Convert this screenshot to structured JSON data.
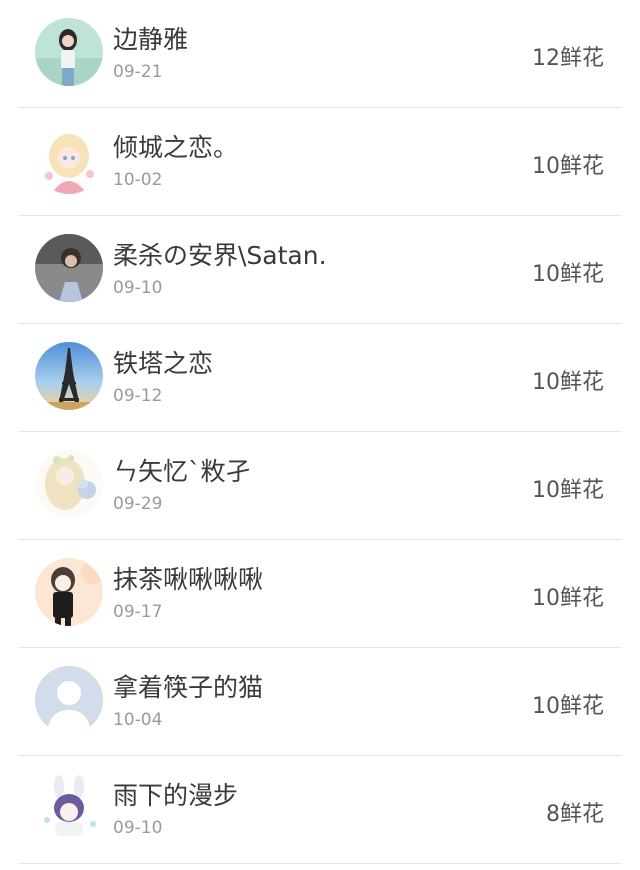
{
  "items": [
    {
      "name": "边静雅",
      "date": "09-21",
      "flowers": "12鲜花",
      "avatar": "girl-photo-avatar"
    },
    {
      "name": "倾城之恋。",
      "date": "10-02",
      "flowers": "10鲜花",
      "avatar": "anime-girl-pink-avatar"
    },
    {
      "name": "柔杀の安界\\Satan.",
      "date": "09-10",
      "flowers": "10鲜花",
      "avatar": "person-photo-avatar"
    },
    {
      "name": "铁塔之恋",
      "date": "09-12",
      "flowers": "10鲜花",
      "avatar": "eiffel-tower-avatar"
    },
    {
      "name": "ㄣ矢忆`敉孑",
      "date": "09-29",
      "flowers": "10鲜花",
      "avatar": "anime-girl-flowers-avatar"
    },
    {
      "name": "抹茶啾啾啾啾",
      "date": "09-17",
      "flowers": "10鲜花",
      "avatar": "anime-girl-dark-hair-avatar"
    },
    {
      "name": "拿着筷子的猫",
      "date": "10-04",
      "flowers": "10鲜花",
      "avatar": "default-user-avatar"
    },
    {
      "name": "雨下的漫步",
      "date": "09-10",
      "flowers": "8鲜花",
      "avatar": "bunny-ears-avatar"
    }
  ]
}
